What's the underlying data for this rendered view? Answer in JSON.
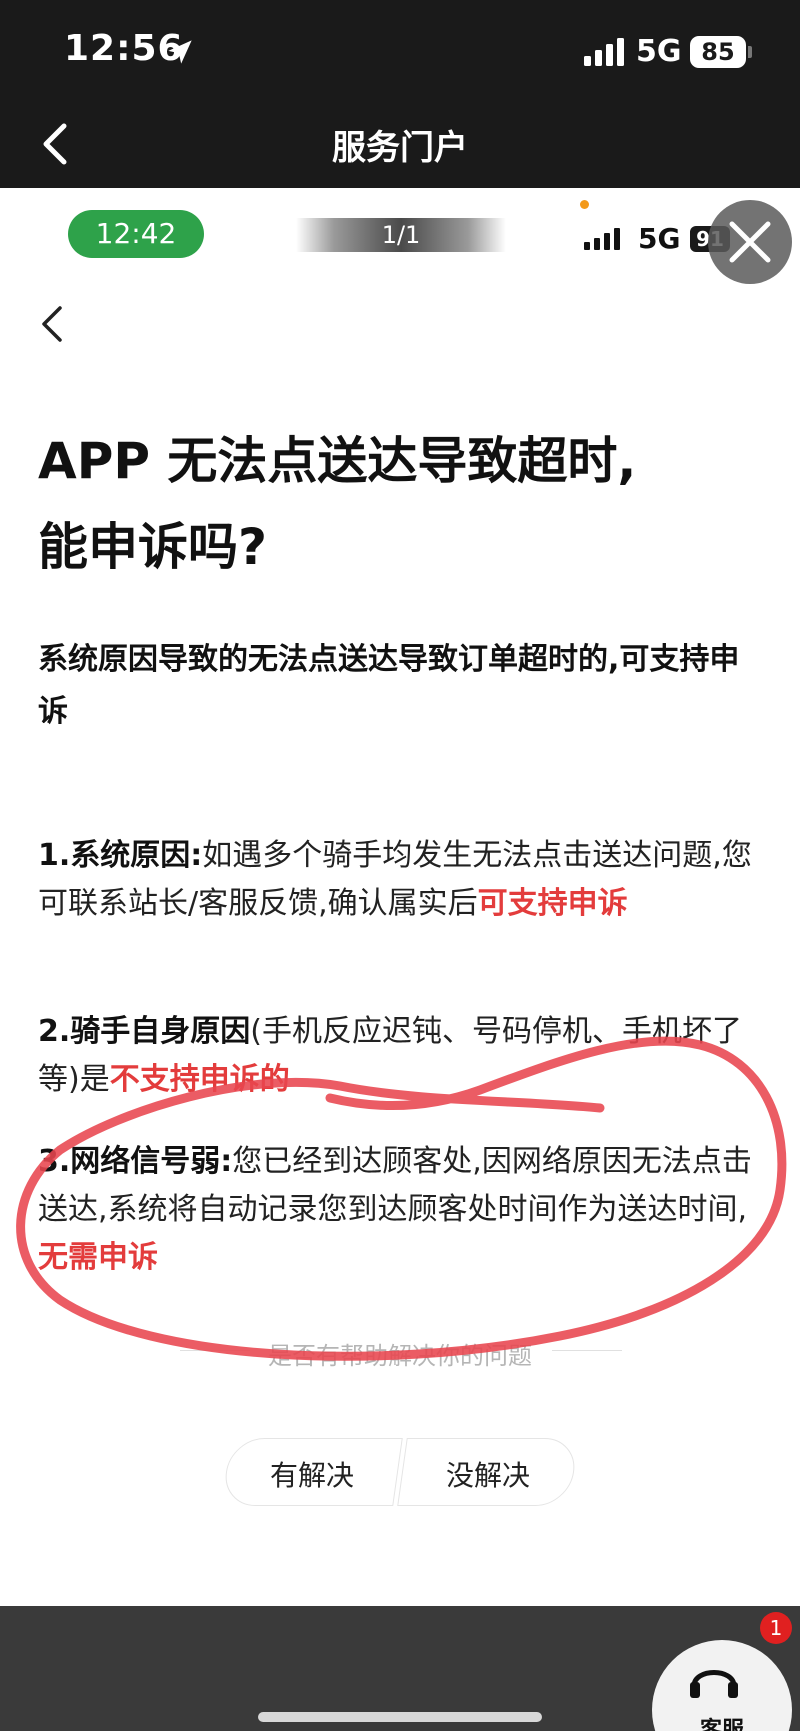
{
  "outer_status": {
    "time": "12:56",
    "network": "5G",
    "battery": "85"
  },
  "nav": {
    "title": "服务门户"
  },
  "inner_status": {
    "time": "12:42",
    "page_indicator": "1/1",
    "network": "5G",
    "battery": "91"
  },
  "article": {
    "title_line1": "APP 无法点送达导致超时,",
    "title_line2": "能申诉吗?",
    "subtitle": "系统原因导致的无法点送达导致订单超时的,可支持申诉",
    "p1": {
      "lead": "1.系统原因:",
      "text": "如遇多个骑手均发生无法点击送达问题,您可联系站长/客服反馈,确认属实后",
      "highlight": "可支持申诉"
    },
    "p2": {
      "lead": "2.骑手自身原因",
      "text": "(手机反应迟钝、号码停机、手机坏了等)是",
      "highlight": "不支持申诉的"
    },
    "p3": {
      "lead": "3.网络信号弱:",
      "text": "您已经到达顾客处,因网络原因无法点击送达,系统将自动记录您到达顾客处时间作为送达时间,",
      "highlight": "无需申诉"
    }
  },
  "feedback": {
    "question": "是否有帮助解决你的问题",
    "resolved": "有解决",
    "unresolved": "没解决"
  },
  "bottom": {
    "badge": "1",
    "cs_label": "客服"
  },
  "colors": {
    "highlight": "#e33c3c",
    "pill_green": "#2ea24a",
    "annotation_red": "#e8454e"
  }
}
